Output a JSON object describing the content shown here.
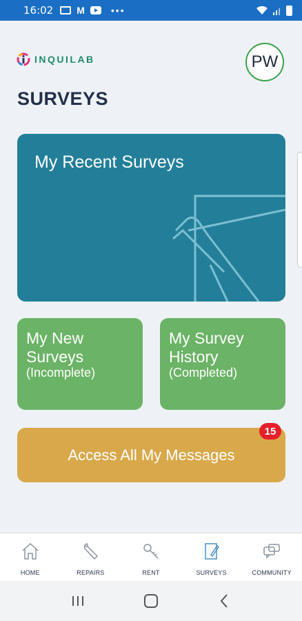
{
  "status_bar": {
    "time": "16:02"
  },
  "header": {
    "logo_text": "INQUILAB",
    "avatar_initials": "PW"
  },
  "page_title": "SURVEYS",
  "cards": {
    "recent": {
      "label": "My Recent Surveys"
    },
    "new": {
      "title": "My New Surveys",
      "subtitle": "(Incomplete)"
    },
    "history": {
      "title": "My Survey History",
      "subtitle": "(Completed)"
    },
    "messages": {
      "label": "Access All My Messages",
      "badge": "15"
    }
  },
  "bottom_nav": [
    {
      "label": "HOME",
      "icon": "home-icon"
    },
    {
      "label": "REPAIRS",
      "icon": "wrench-icon"
    },
    {
      "label": "RENT",
      "icon": "key-icon"
    },
    {
      "label": "SURVEYS",
      "icon": "survey-icon"
    },
    {
      "label": "COMMUNITY",
      "icon": "chat-icon"
    }
  ],
  "colors": {
    "status_bar": "#1a6fc4",
    "recent_card": "#237f99",
    "green_card": "#6bb366",
    "messages_card": "#d8a84a",
    "badge": "#e5202a"
  }
}
